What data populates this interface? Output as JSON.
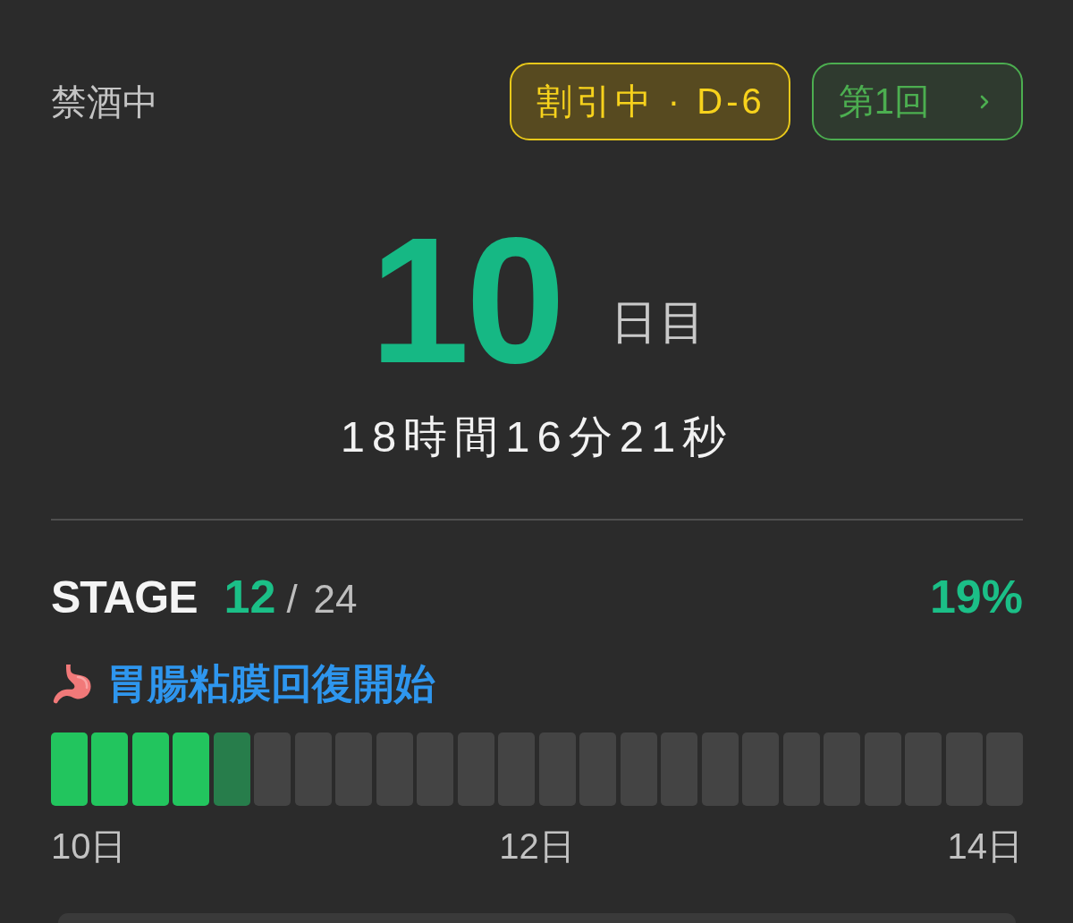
{
  "header": {
    "status": "禁酒中",
    "badges": [
      {
        "kind": "discount",
        "label": "割引中 · D-6"
      },
      {
        "kind": "attempt",
        "label": "第1回"
      }
    ]
  },
  "counter": {
    "days": "10",
    "days_unit": "日目",
    "elapsed": "18時間16分21秒"
  },
  "stage": {
    "label": "STAGE",
    "current": "12",
    "separator": "/",
    "total": "24",
    "percent": "19%",
    "milestone": "胃腸粘膜回復開始",
    "segments": [
      {
        "kind": "done"
      },
      {
        "kind": "done"
      },
      {
        "kind": "done"
      },
      {
        "kind": "done"
      },
      {
        "kind": "current"
      },
      {
        "kind": "pending"
      },
      {
        "kind": "pending"
      },
      {
        "kind": "pending"
      },
      {
        "kind": "pending"
      },
      {
        "kind": "pending"
      },
      {
        "kind": "pending"
      },
      {
        "kind": "pending"
      },
      {
        "kind": "pending"
      },
      {
        "kind": "pending"
      },
      {
        "kind": "pending"
      },
      {
        "kind": "pending"
      },
      {
        "kind": "pending"
      },
      {
        "kind": "pending"
      },
      {
        "kind": "pending"
      },
      {
        "kind": "pending"
      },
      {
        "kind": "pending"
      },
      {
        "kind": "pending"
      },
      {
        "kind": "pending"
      },
      {
        "kind": "pending"
      }
    ],
    "scale_labels": [
      "10日",
      "12日",
      "14日"
    ]
  }
}
